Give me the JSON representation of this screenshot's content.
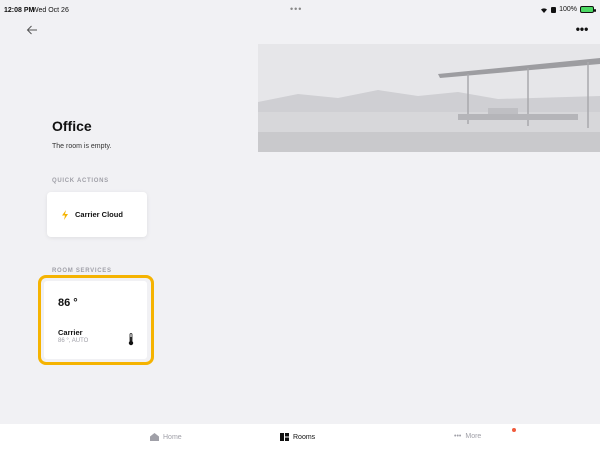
{
  "status_bar": {
    "time": "12:08 PM",
    "date": "Wed Oct 26",
    "dots": "•••",
    "battery": "100%"
  },
  "header": {
    "back_icon": "arrow-left-icon",
    "more_label": "•••"
  },
  "room": {
    "title": "Office",
    "status": "The room is empty."
  },
  "quick_actions": {
    "label": "QUICK ACTIONS",
    "items": [
      {
        "label": "Carrier Cloud",
        "icon": "bolt-icon",
        "icon_color": "#f5b301"
      }
    ]
  },
  "room_services": {
    "label": "ROOM SERVICES",
    "items": [
      {
        "temperature": "86 °",
        "name": "Carrier",
        "status": "86 °, AUTO",
        "icon": "thermometer-icon"
      }
    ]
  },
  "bottom_nav": {
    "items": [
      {
        "label": "Home",
        "icon": "home-icon"
      },
      {
        "label": "Rooms",
        "icon": "rooms-icon"
      },
      {
        "label": "More",
        "icon": "more-icon"
      }
    ]
  },
  "colors": {
    "background": "#f1f1f4",
    "accent": "#f5b301",
    "badge": "#f05a3c",
    "battery": "#4cd964"
  }
}
